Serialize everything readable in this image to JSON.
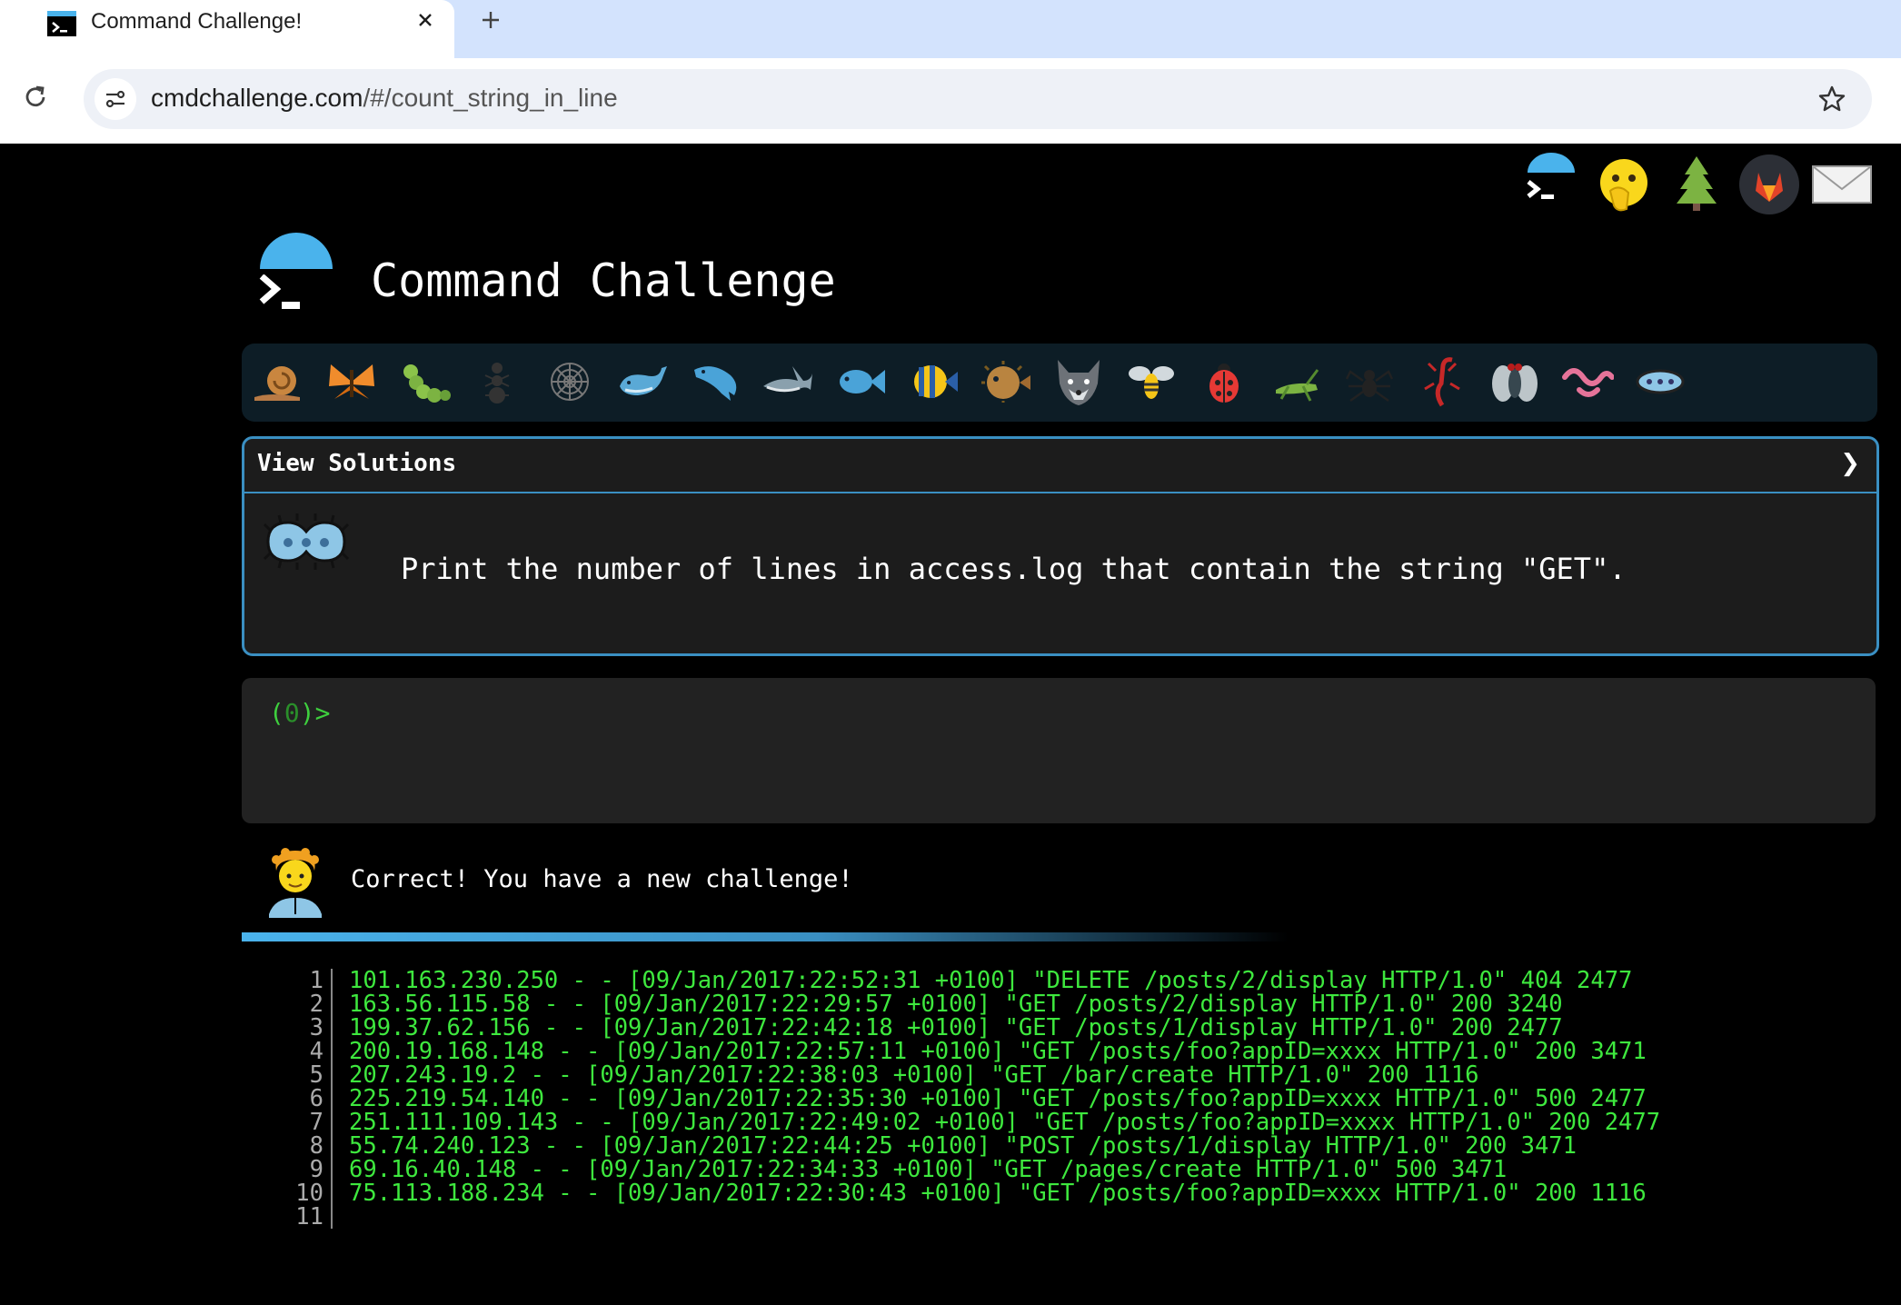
{
  "browser": {
    "tab_title": "Command Challenge!",
    "url_host": "cmdchallenge.com",
    "url_path": "/#/count_string_in_line"
  },
  "header": {
    "site_title": "Command Challenge",
    "top_icons": [
      "terminal-logo-icon",
      "face-with-hand-over-mouth-icon",
      "evergreen-tree-icon",
      "gitlab-icon",
      "envelope-icon"
    ]
  },
  "critters": [
    "snail",
    "butterfly",
    "caterpillar",
    "ant",
    "spider-web",
    "whale",
    "dolphin",
    "shark",
    "fish",
    "tropical-fish",
    "blowfish",
    "wolf",
    "bee",
    "ladybug",
    "cricket",
    "spider",
    "scorpion",
    "fly",
    "worm",
    "microbe"
  ],
  "solutions_panel": {
    "label": "View Solutions",
    "chevron": "❯",
    "challenge_text": "Print the number of lines in access.log that contain the string \"GET\"."
  },
  "terminal": {
    "prompt_open": "(",
    "prompt_count": "0",
    "prompt_close": ")>"
  },
  "result": {
    "message": "Correct! You have a new challenge!",
    "progress": 0.64
  },
  "editor": {
    "line_numbers": [
      "1",
      "2",
      "3",
      "4",
      "5",
      "6",
      "7",
      "8",
      "9",
      "10",
      "11"
    ],
    "lines": [
      "101.163.230.250 - - [09/Jan/2017:22:52:31 +0100] \"DELETE /posts/2/display HTTP/1.0\" 404 2477",
      "163.56.115.58 - - [09/Jan/2017:22:29:57 +0100] \"GET /posts/2/display HTTP/1.0\" 200 3240",
      "199.37.62.156 - - [09/Jan/2017:22:42:18 +0100] \"GET /posts/1/display HTTP/1.0\" 200 2477",
      "200.19.168.148 - - [09/Jan/2017:22:57:11 +0100] \"GET /posts/foo?appID=xxxx HTTP/1.0\" 200 3471",
      "207.243.19.2 - - [09/Jan/2017:22:38:03 +0100] \"GET /bar/create HTTP/1.0\" 200 1116",
      "225.219.54.140 - - [09/Jan/2017:22:35:30 +0100] \"GET /posts/foo?appID=xxxx HTTP/1.0\" 500 2477",
      "251.111.109.143 - - [09/Jan/2017:22:49:02 +0100] \"GET /posts/foo?appID=xxxx HTTP/1.0\" 200 2477",
      "55.74.240.123 - - [09/Jan/2017:22:44:25 +0100] \"POST /posts/1/display HTTP/1.0\" 200 3471",
      "69.16.40.148 - - [09/Jan/2017:22:34:33 +0100] \"GET /pages/create HTTP/1.0\" 500 3471",
      "75.113.188.234 - - [09/Jan/2017:22:30:43 +0100] \"GET /posts/foo?appID=xxxx HTTP/1.0\" 200 1116",
      ""
    ]
  },
  "colors": {
    "accent": "#4ab3ec",
    "terminal_green": "#3ee83e",
    "panel_border": "#3a8fc2"
  }
}
